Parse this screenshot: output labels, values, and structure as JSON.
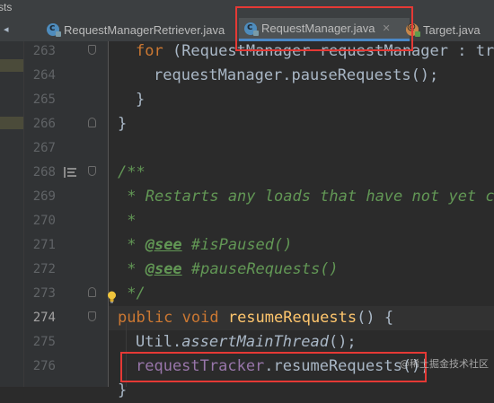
{
  "breadcrumb": "sts",
  "tabs": [
    {
      "label": "RequestManagerRetriever.java",
      "icon": "class-icon",
      "active": false
    },
    {
      "label": "RequestManager.java",
      "icon": "class-icon",
      "active": true
    },
    {
      "label": "Target.java",
      "icon": "annotation-icon",
      "active": false
    }
  ],
  "lines": [
    {
      "num": "263"
    },
    {
      "num": "264"
    },
    {
      "num": "265"
    },
    {
      "num": "266"
    },
    {
      "num": "267"
    },
    {
      "num": "268"
    },
    {
      "num": "269"
    },
    {
      "num": "270"
    },
    {
      "num": "271"
    },
    {
      "num": "272"
    },
    {
      "num": "273"
    },
    {
      "num": "274"
    },
    {
      "num": "275"
    },
    {
      "num": "276"
    }
  ],
  "code": {
    "l263_kw": "for",
    "l263_rest": " (RequestManager requestManager : tre",
    "l264": "requestManager.pauseRequests();",
    "l265": "}",
    "l266": "}",
    "l268": "/**",
    "l269": " * Restarts any loads that have not yet co",
    "l270": " *",
    "l271_star": " * ",
    "l271_tag": "@see",
    "l271_link": " #isPaused()",
    "l272_star": " * ",
    "l272_tag": "@see",
    "l272_link": " #pauseRequests()",
    "l273": " */",
    "l274_kw": "public void ",
    "l274_fn": "resumeRequests",
    "l274_rest": "() {",
    "l275_a": "Util.",
    "l275_b": "assertMainThread",
    "l275_c": "();",
    "l276_field": "requestTracker",
    "l276_rest": ".resumeRequests();",
    "l277": "}"
  },
  "watermark": "@稀土掘金技术社区",
  "colors": {
    "highlight_box": "#e53935",
    "keyword": "#cc7832",
    "comment": "#629755",
    "method": "#ffc66d",
    "field": "#9876aa"
  }
}
